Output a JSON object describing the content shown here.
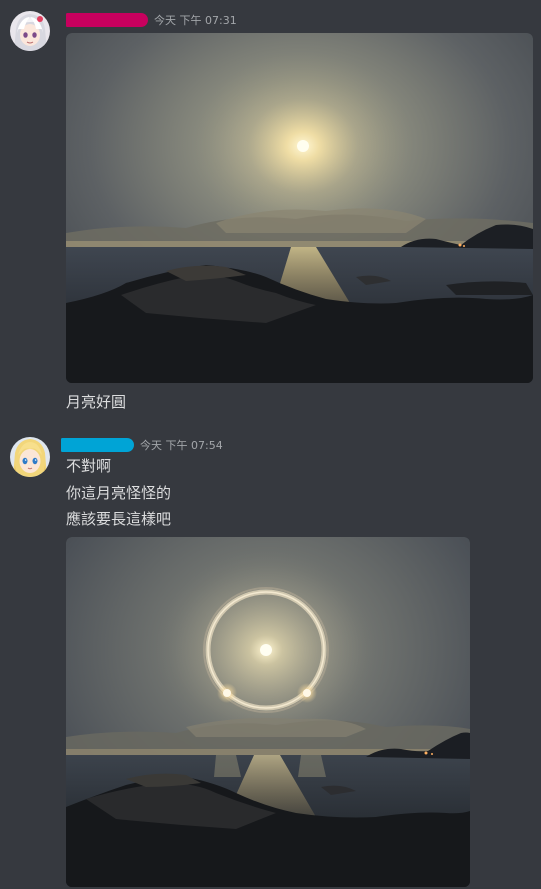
{
  "messages": [
    {
      "author_color": "#c8005e",
      "timestamp": "今天 下午 07:31",
      "image_alt": "moon-over-sea-photo",
      "text_lines": [
        "月亮好圓"
      ]
    },
    {
      "author_color": "#00a4d6",
      "timestamp": "今天 下午 07:54",
      "text_lines": [
        "不對啊",
        "你這月亮怪怪的",
        "應該要長這樣吧"
      ],
      "image_alt": "moon-halo-photo"
    }
  ],
  "colors": {
    "background": "#36393f",
    "text": "#dcddde",
    "timestamp": "#a3a6aa"
  }
}
